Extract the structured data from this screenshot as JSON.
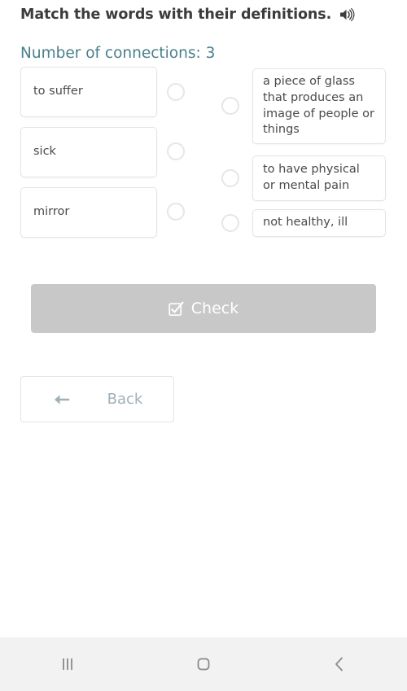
{
  "exercise": {
    "title": "Match the words with their definitions.",
    "audio_icon": "speaker-icon",
    "connections_label": "Number of connections: 3",
    "accent_color": "#4a7f8c",
    "words": [
      {
        "text": "to suffer"
      },
      {
        "text": "sick"
      },
      {
        "text": "mirror"
      }
    ],
    "definitions": [
      {
        "text": "a piece of glass that produces an image of people or things"
      },
      {
        "text": "to have physical or mental pain"
      },
      {
        "text": "not healthy, ill"
      }
    ]
  },
  "actions": {
    "check": {
      "label": "Check",
      "icon": "check-square-icon",
      "background_color": "#c8c8c8",
      "text_color": "#ffffff",
      "disabled": true
    },
    "back": {
      "label": "Back",
      "icon": "arrow-left-icon",
      "text_color": "#9fb0b8",
      "border_color": "#dfe5e8"
    }
  },
  "navbar": {
    "background_color": "#f2f2f2",
    "buttons": [
      {
        "name": "recents",
        "icon": "recents-icon"
      },
      {
        "name": "home",
        "icon": "home-icon"
      },
      {
        "name": "back",
        "icon": "chevron-left-icon"
      }
    ]
  }
}
